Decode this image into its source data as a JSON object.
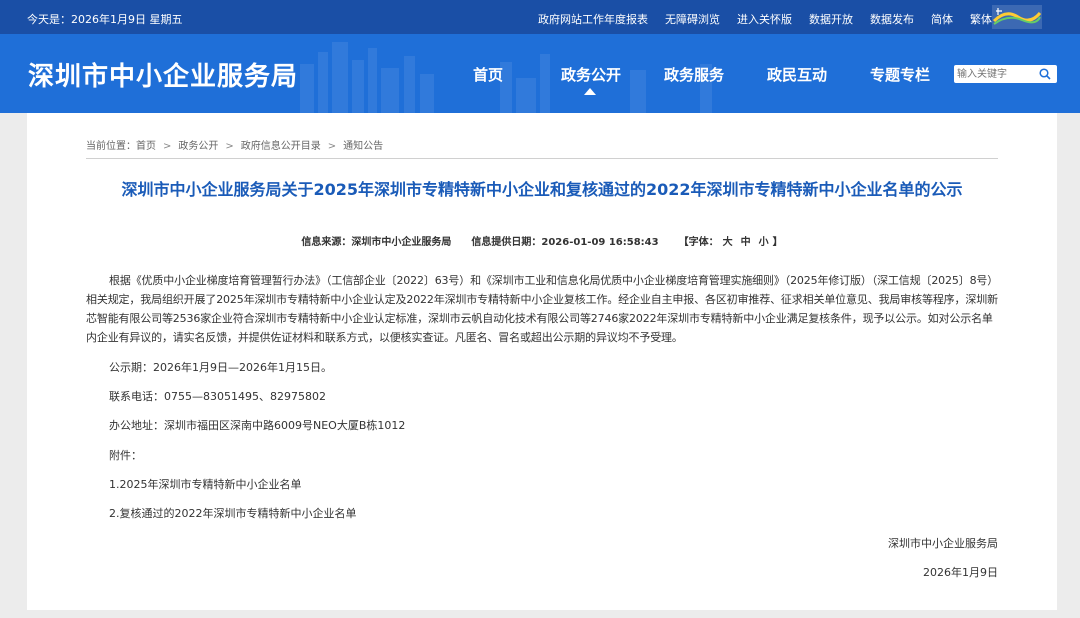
{
  "topbar": {
    "today": "今天是：2026年1月9日 星期五",
    "links": [
      "政府网站工作年度报表",
      "无障碍浏览",
      "进入关怀版",
      "数据开放",
      "数据发布",
      "简体",
      "繁体"
    ]
  },
  "header": {
    "site_title": "深圳市中小企业服务局",
    "nav": [
      "首页",
      "政务公开",
      "政务服务",
      "政民互动",
      "专题专栏"
    ],
    "active_nav": "政务公开",
    "search_placeholder": "输入关键字",
    "brand_color": "#1f6fd8"
  },
  "breadcrumb": {
    "prefix": "当前位置：",
    "items": [
      "首页",
      "政务公开",
      "政府信息公开目录",
      "通知公告"
    ]
  },
  "article": {
    "title": "深圳市中小企业服务局关于2025年深圳市专精特新中小企业和复核通过的2022年深圳市专精特新中小企业名单的公示",
    "source_label": "信息来源：",
    "source": "深圳市中小企业服务局",
    "date_label": "信息提供日期：",
    "date": "2026-01-09 16:58:43",
    "font_label": "【字体：",
    "font_sizes": [
      "大",
      "中",
      "小"
    ],
    "font_close": "】",
    "paragraph": "根据《优质中小企业梯度培育管理暂行办法》（工信部企业〔2022〕63号）和《深圳市工业和信息化局优质中小企业梯度培育管理实施细则》（2025年修订版）（深工信规〔2025〕8号）相关规定，我局组织开展了2025年深圳市专精特新中小企业认定及2022年深圳市专精特新中小企业复核工作。经企业自主申报、各区初审推荐、征求相关单位意见、我局审核等程序，深圳新芯智能有限公司等2536家企业符合深圳市专精特新中小企业认定标准，深圳市云帆自动化技术有限公司等2746家2022年深圳市专精特新中小企业满足复核条件，现予以公示。如对公示名单内企业有异议的，请实名反馈，并提供佐证材料和联系方式，以便核实查证。凡匿名、冒名或超出公示期的异议均不予受理。",
    "period": "公示期：2026年1月9日—2026年1月15日。",
    "phone": "联系电话：0755—83051495、82975802",
    "address": "办公地址：深圳市福田区深南中路6009号NEO大厦B栋1012",
    "attach_label": "附件：",
    "attachments": [
      "1.2025年深圳市专精特新中小企业名单",
      "2.复核通过的2022年深圳市专精特新中小企业名单"
    ],
    "sign_org": "深圳市中小企业服务局",
    "sign_date": "2026年1月9日",
    "title_color": "#1a5bb8"
  }
}
